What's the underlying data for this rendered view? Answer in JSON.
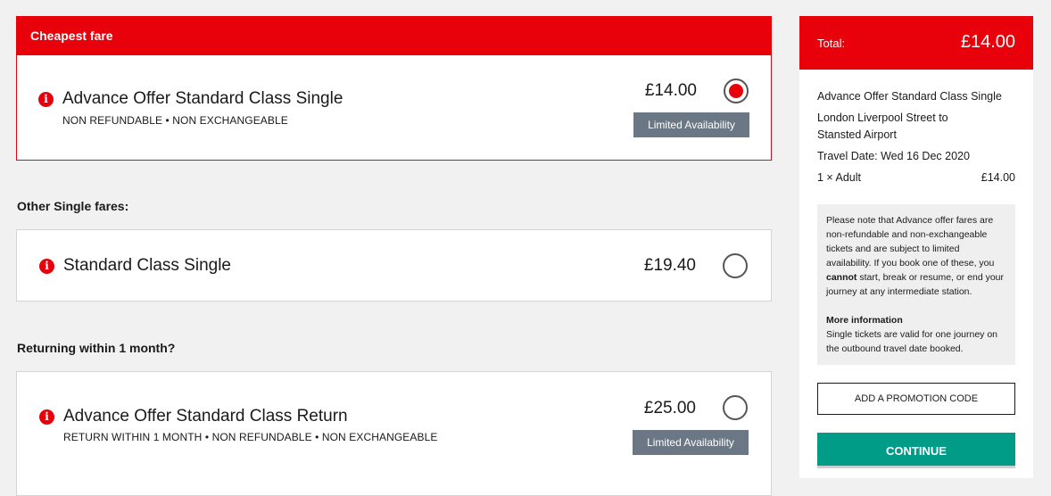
{
  "cheapest": {
    "header": "Cheapest fare",
    "fare": {
      "name": "Advance Offer Standard Class Single",
      "conditions": "NON REFUNDABLE • NON EXCHANGEABLE",
      "price": "£14.00",
      "badge": "Limited Availability",
      "selected": true
    }
  },
  "other_single": {
    "label": "Other Single fares:",
    "fare": {
      "name": "Standard Class Single",
      "price": "£19.40",
      "selected": false
    }
  },
  "returning": {
    "label": "Returning within 1 month?",
    "fare": {
      "name": "Advance Offer Standard Class Return",
      "conditions": "RETURN WITHIN 1 MONTH • NON REFUNDABLE • NON EXCHANGEABLE",
      "price": "£25.00",
      "badge": "Limited Availability",
      "selected": false
    }
  },
  "summary": {
    "total_label": "Total:",
    "total_value": "£14.00",
    "fare_name": "Advance Offer Standard Class Single",
    "route_line1": "London Liverpool Street to",
    "route_line2": "Stansted Airport",
    "travel_date": "Travel Date: Wed 16 Dec 2020",
    "passengers": "1 × Adult",
    "passenger_price": "£14.00",
    "note_part1": "Please note that Advance offer fares are non-refundable and non-exchangeable tickets and are subject to limited availability. If you book one of these, you",
    "note_bold": "cannot",
    "note_part2": "start, break or resume, or end your journey at any intermediate station.",
    "more_info_title": "More information",
    "more_info_text": "Single tickets are valid for one journey on the outbound travel date booked.",
    "promo_label": "ADD A PROMOTION CODE",
    "continue_label": "CONTINUE"
  },
  "colors": {
    "brand_red": "#e8000b",
    "continue_green": "#009c87",
    "badge_grey": "#6b7784"
  },
  "icons": {
    "info": "info-icon"
  }
}
